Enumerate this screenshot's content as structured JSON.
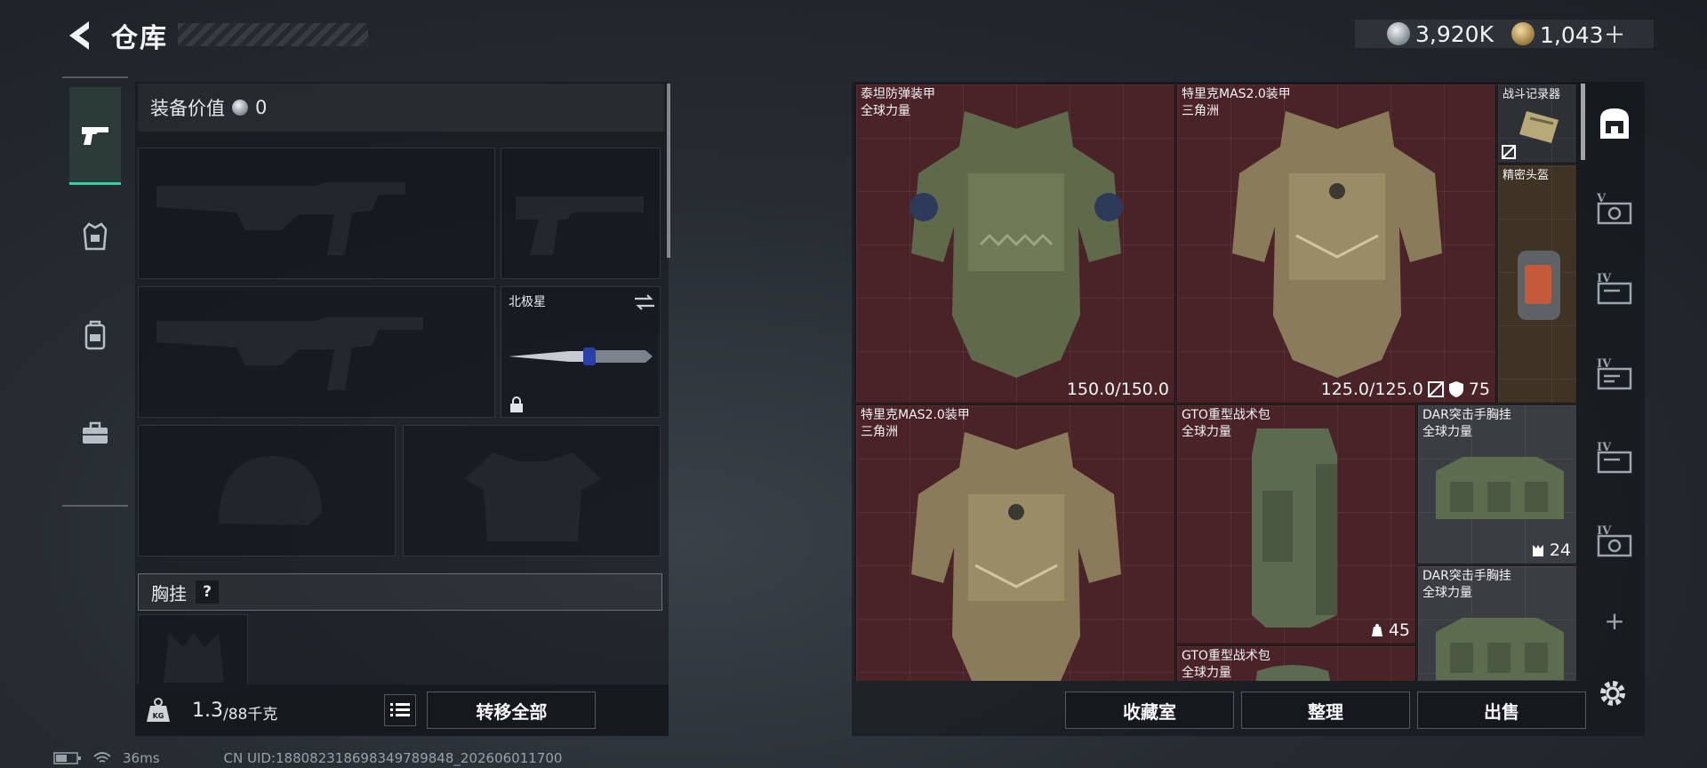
{
  "header": {
    "title": "仓库",
    "currency_silver": "3,920K",
    "currency_gold": "1,043＋"
  },
  "equipment": {
    "value_label": "装备价值",
    "value": "0",
    "knife_name": "北极星",
    "chest_rig_label": "胸挂",
    "help_label": "?",
    "weight_current": "1.3",
    "weight_max": "/88千克",
    "transfer_all": "转移全部"
  },
  "storage": {
    "items": [
      {
        "name": "泰坦防弹装甲",
        "source": "全球力量",
        "stat": "150.0/150.0"
      },
      {
        "name": "特里克MAS2.0装甲",
        "source": "三角洲",
        "stat": "125.0/125.0",
        "shield": "75"
      },
      {
        "name": "战斗记录器"
      },
      {
        "name": "精密头盔"
      },
      {
        "name": "特里克MAS2.0装甲",
        "source": "三角洲"
      },
      {
        "name": "GTO重型战术包",
        "source": "全球力量",
        "stat": "45"
      },
      {
        "name": "DAR突击手胸挂",
        "source": "全球力量",
        "stat": "24"
      },
      {
        "name": "DAR突击手胸挂",
        "source": "全球力量"
      },
      {
        "name": "GTO重型战术包",
        "source": "全球力量"
      }
    ],
    "side_labels": [
      "V",
      "IV",
      "IV",
      "IV",
      "IV",
      "+"
    ],
    "buttons": {
      "collection": "收藏室",
      "organize": "整理",
      "sell": "出售"
    }
  },
  "footer": {
    "ping": "36ms",
    "uid": "CN UID:18808231869834978984​8_202606011700"
  },
  "colors": {
    "accent": "#2fd0a4",
    "item_bg_red": "#4a2329"
  }
}
